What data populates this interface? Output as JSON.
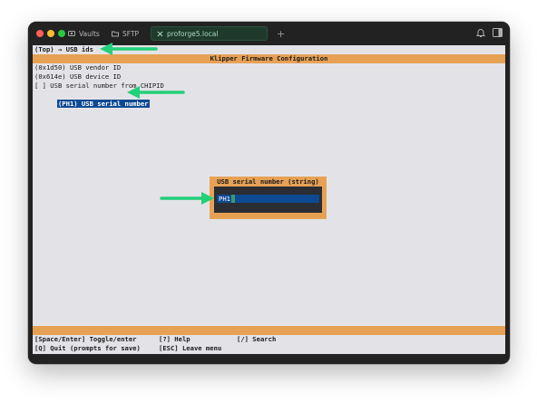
{
  "window": {
    "tabs": [
      {
        "label": "Vaults",
        "icon": "vault-icon"
      },
      {
        "label": "SFTP",
        "icon": "folder-icon"
      },
      {
        "label": "proforge5.local",
        "icon": "close-icon",
        "active": true
      }
    ],
    "new_tab_label": "+",
    "colors": {
      "accent_green": "#22d07a",
      "tab_active_bg": "#1f3a2c",
      "menu_orange": "#e7a155",
      "selection_blue": "#0d4a93"
    }
  },
  "terminal": {
    "breadcrumb": "(Top) → USB ids",
    "title": "Klipper Firmware Configuration",
    "menu_items": [
      {
        "text": "(0x1d50) USB vendor ID",
        "selected": false
      },
      {
        "text": "(0x614e) USB device ID",
        "selected": false
      },
      {
        "text": "[ ] USB serial number from CHIPID",
        "selected": false
      },
      {
        "text": "(PH1) USB serial number",
        "selected": true
      }
    ],
    "dialog": {
      "title": "USB serial number (string)",
      "value": "PH1"
    },
    "footer": {
      "row1": [
        "[Space/Enter] Toggle/enter",
        "[?] Help",
        "[/] Search"
      ],
      "row2": [
        "[Q] Quit (prompts for save)",
        "[ESC] Leave menu"
      ]
    }
  }
}
